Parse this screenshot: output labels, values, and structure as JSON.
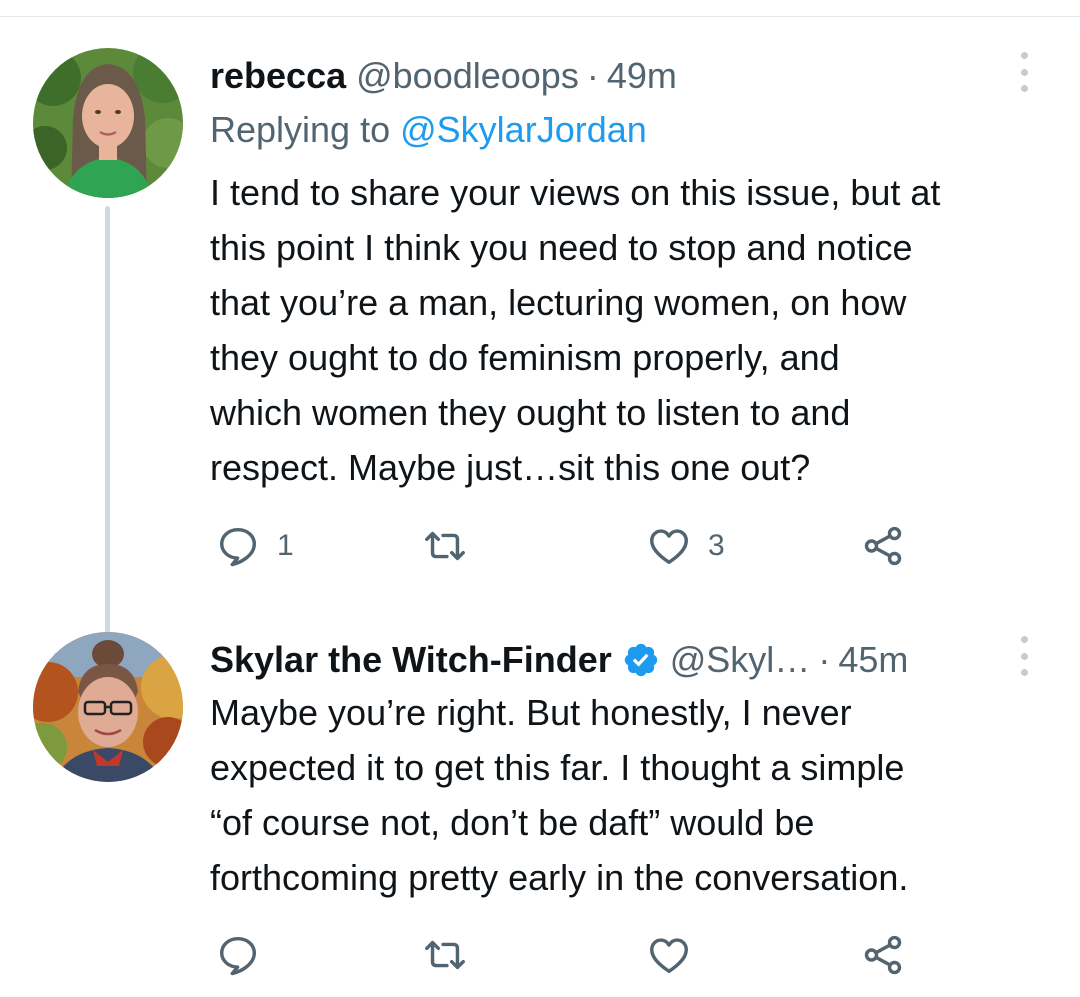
{
  "tweets": [
    {
      "author_name": "rebecca",
      "handle": "@boodleoops",
      "separator": "·",
      "time": "49m",
      "reply_prefix": "Replying to",
      "reply_handle": "@SkylarJordan",
      "text": "I tend to share your views on this issue, but at\nthis point I think you need to stop and notice\nthat you’re a man, lecturing women, on how\nthey ought to do feminism properly, and\nwhich women they ought to listen to and\nrespect. Maybe just…sit this one out?",
      "reply_count": "1",
      "retweet_count": "",
      "like_count": "3"
    },
    {
      "author_name": "Skylar the Witch-Finder",
      "handle": "@Skyl…",
      "separator": "·",
      "time": "45m",
      "verified": true,
      "text": "Maybe you’re right. But honestly, I never\nexpected it to get this far. I thought a simple\n“of course not, don’t be daft” would be\nforthcoming pretty early in the conversation.",
      "reply_count": "",
      "retweet_count": "",
      "like_count": ""
    }
  ],
  "icons": {
    "reply": "speech-bubble-icon",
    "retweet": "retweet-arrows-icon",
    "like": "heart-icon",
    "share": "share-nodes-icon",
    "more": "vertical-ellipsis-icon",
    "verified": "verified-badge-icon"
  },
  "colors": {
    "link": "#1d9bf0",
    "secondary_text": "#536471",
    "primary_text": "#0f1419",
    "thread_line": "#cfd9de",
    "verified": "#1d9bf0"
  }
}
